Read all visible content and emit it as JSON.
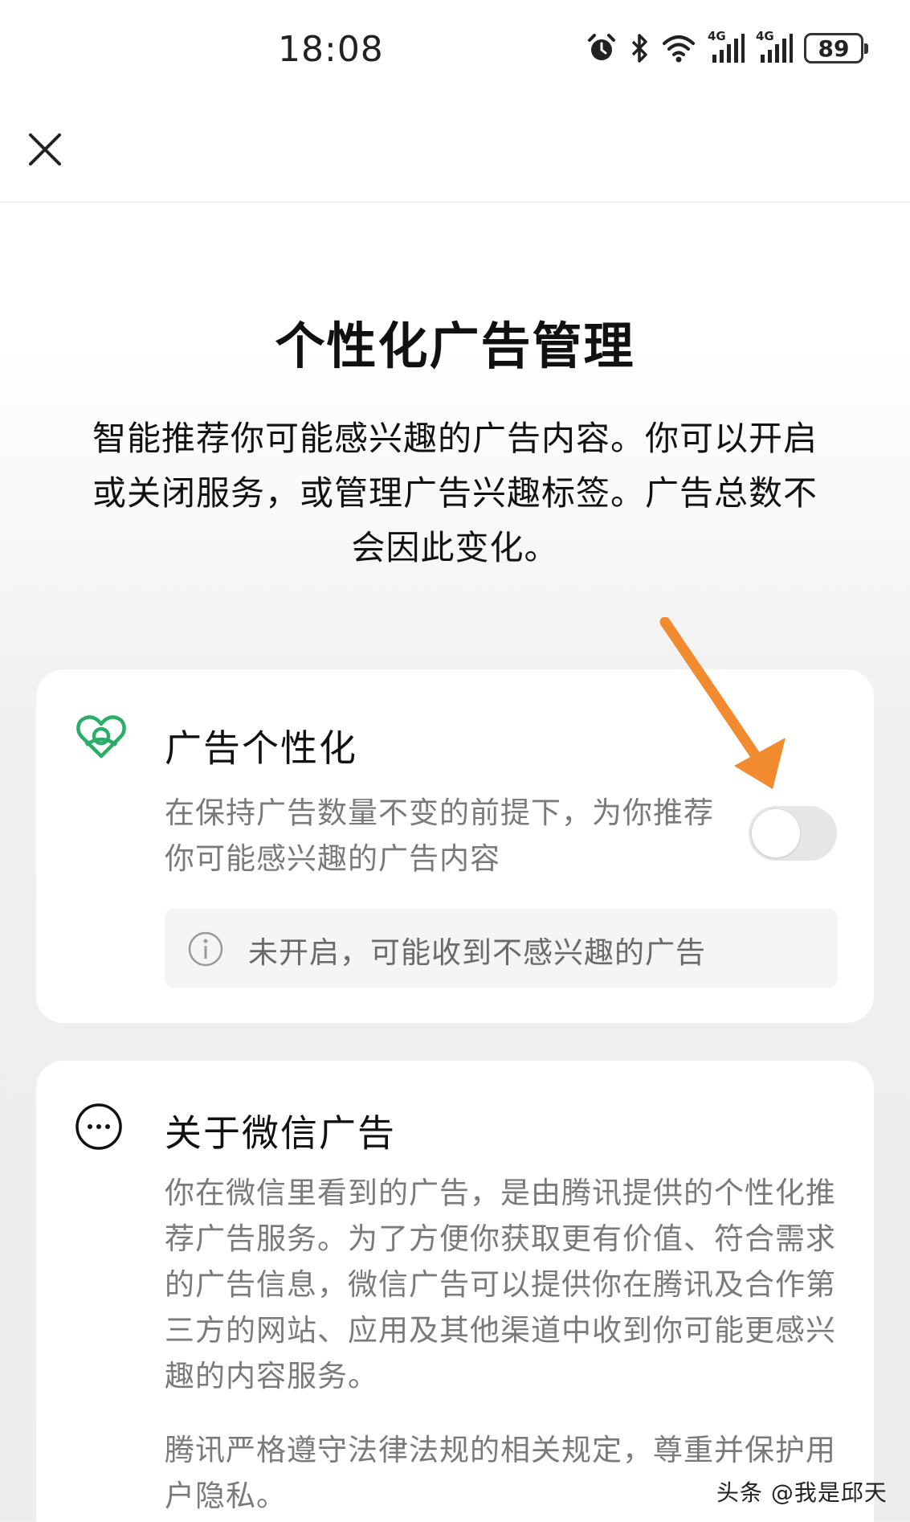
{
  "status_bar": {
    "time": "18:08",
    "battery": "89",
    "network_1": "4G",
    "network_2": "4G",
    "icons": [
      "alarm-icon",
      "bluetooth-icon",
      "wifi-icon",
      "signal-icon",
      "signal-icon",
      "battery-icon"
    ]
  },
  "nav": {
    "close_icon": "close-icon"
  },
  "page": {
    "title": "个性化广告管理",
    "description": "智能推荐你可能感兴趣的广告内容。你可以开启或关闭服务，或管理广告兴趣标签。广告总数不会因此变化。"
  },
  "ad_personalization": {
    "icon": "heart-icon",
    "title": "广告个性化",
    "description": "在保持广告数量不变的前提下，为你推荐你可能感兴趣的广告内容",
    "toggle_state": "off",
    "notice": "未开启，可能收到不感兴趣的广告",
    "notice_icon": "info-icon",
    "accent_color": "#2aae67"
  },
  "about": {
    "icon": "more-icon",
    "title": "关于微信广告",
    "paragraph_1": "你在微信里看到的广告，是由腾讯提供的个性化推荐广告服务。为了方便你获取更有价值、符合需求的广告信息，微信广告可以提供你在腾讯及合作第三方的网站、应用及其他渠道中收到你可能更感兴趣的内容服务。",
    "paragraph_2": "腾讯严格遵守法律法规的相关规定，尊重并保护用户隐私。"
  },
  "annotation": {
    "arrow_color": "#f28a30"
  },
  "watermark": "头条 @我是邱天"
}
